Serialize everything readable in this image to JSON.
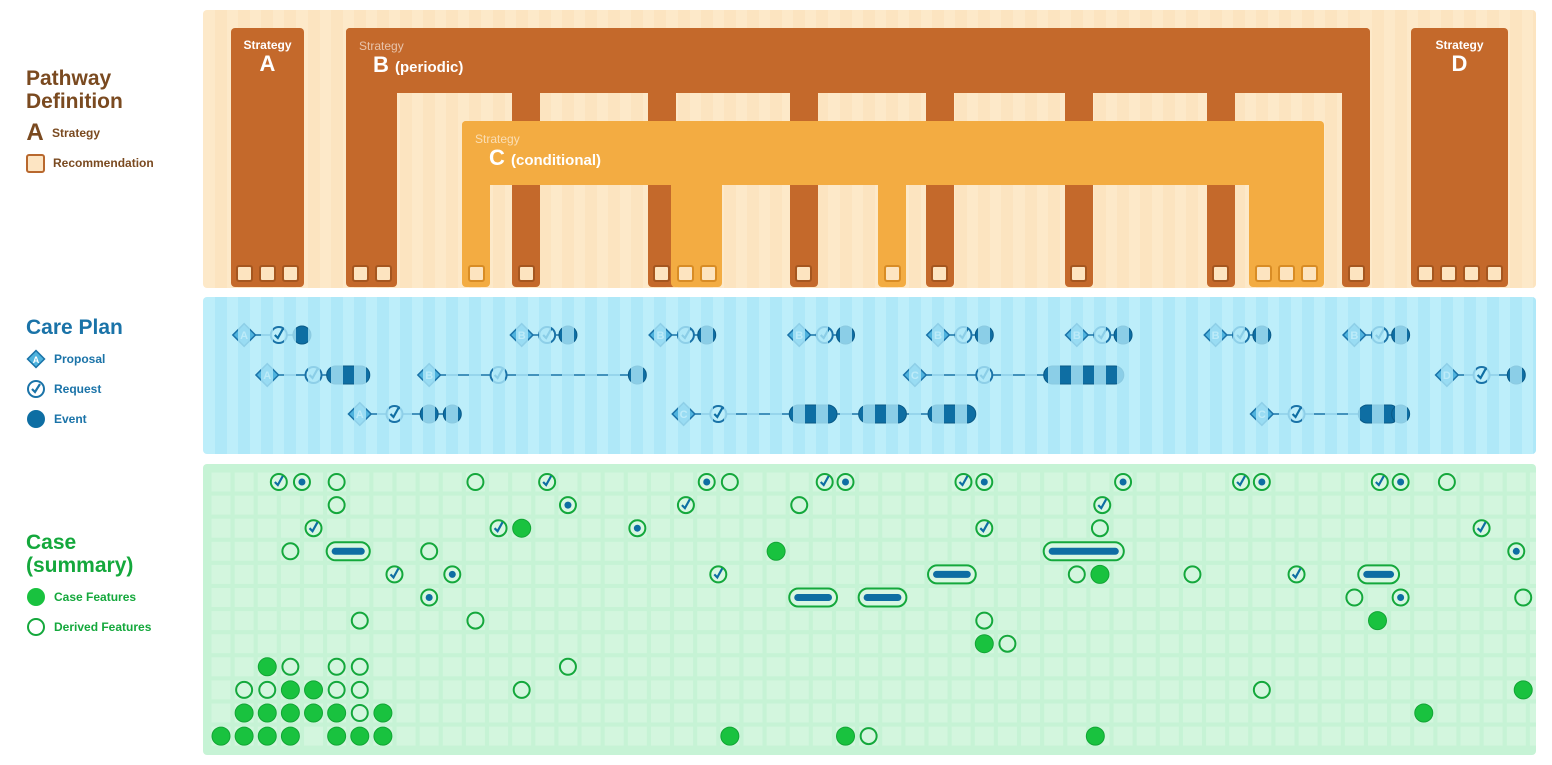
{
  "legends": {
    "pathway": {
      "title_line1": "Pathway",
      "title_line2": "Definition",
      "items": [
        {
          "symbol": "A",
          "label": "Strategy"
        },
        {
          "symbol": "recommendation-square",
          "label": "Recommendation"
        }
      ]
    },
    "careplan": {
      "title": "Care Plan",
      "items": [
        {
          "symbol": "A",
          "label": "Proposal"
        },
        {
          "symbol": "check-circle",
          "label": "Request"
        },
        {
          "symbol": "filled-circle",
          "label": "Event"
        }
      ]
    },
    "case": {
      "title_line1": "Case",
      "title_line2": "(summary)",
      "items": [
        {
          "symbol": "filled-circle",
          "label": "Case Features"
        },
        {
          "symbol": "hollow-circle",
          "label": "Derived Features"
        }
      ]
    }
  },
  "colors": {
    "pathway_text": "#7a4a20",
    "careplan_text": "#1a73a8",
    "case_text": "#14a83c",
    "strategy_dark": "#c4692b",
    "strategy_light": "#f3ac42",
    "event_blue": "#0e6ea3",
    "proposal_blue": "#4fb3de",
    "case_green": "#19c23f"
  },
  "pathway": {
    "strategies": [
      {
        "id": "A",
        "caption": "Strategy",
        "letter": "A",
        "suffix": "",
        "kind": "simple",
        "recommendations": 3
      },
      {
        "id": "B",
        "caption": "Strategy",
        "letter": "B",
        "suffix": "(periodic)",
        "kind": "periodic",
        "prong_recommendations": [
          2,
          1,
          1,
          1,
          1,
          1,
          1,
          1,
          1
        ]
      },
      {
        "id": "C",
        "caption": "Strategy",
        "letter": "C",
        "suffix": "(conditional)",
        "kind": "conditional",
        "prong_recommendations": [
          1,
          3,
          1,
          3
        ]
      },
      {
        "id": "D",
        "caption": "Strategy",
        "letter": "D",
        "suffix": "",
        "kind": "simple",
        "recommendations": 4
      }
    ]
  },
  "careplan": {
    "tracks": [
      {
        "strategy": "A",
        "lane": 0,
        "proposal": 1,
        "request": 2.5,
        "events": [
          {
            "t": 3.5
          }
        ]
      },
      {
        "strategy": "B",
        "lane": 0,
        "proposal": 13,
        "request": 14.1,
        "events": [
          {
            "t": 15
          }
        ]
      },
      {
        "strategy": "B",
        "lane": 0,
        "proposal": 19,
        "request": 20.1,
        "events": [
          {
            "t": 21
          }
        ]
      },
      {
        "strategy": "B",
        "lane": 0,
        "proposal": 25,
        "request": 26.1,
        "events": [
          {
            "t": 27
          }
        ]
      },
      {
        "strategy": "B",
        "lane": 0,
        "proposal": 31,
        "request": 32.1,
        "events": [
          {
            "t": 33
          }
        ]
      },
      {
        "strategy": "B",
        "lane": 0,
        "proposal": 37,
        "request": 38.1,
        "events": [
          {
            "t": 39
          }
        ]
      },
      {
        "strategy": "B",
        "lane": 0,
        "proposal": 43,
        "request": 44.1,
        "events": [
          {
            "t": 45
          }
        ]
      },
      {
        "strategy": "B",
        "lane": 0,
        "proposal": 49,
        "request": 50.1,
        "events": [
          {
            "t": 51
          }
        ]
      },
      {
        "strategy": "A",
        "lane": 1,
        "proposal": 2,
        "request": 4,
        "events": [
          {
            "t": 5,
            "t2": 6
          }
        ]
      },
      {
        "strategy": "B",
        "lane": 1,
        "proposal": 9,
        "request": 12,
        "events": [
          {
            "t": 18
          }
        ]
      },
      {
        "strategy": "C",
        "lane": 1,
        "proposal": 30,
        "request": 33,
        "events": [
          {
            "t": 36,
            "t2": 38.6
          }
        ]
      },
      {
        "strategy": "D",
        "lane": 1,
        "proposal": 53,
        "request": 54.5,
        "events": [
          {
            "t": 56
          }
        ]
      },
      {
        "strategy": "A",
        "lane": 2,
        "proposal": 6,
        "request": 7.5,
        "events": [
          {
            "t": 9
          },
          {
            "t": 10
          }
        ]
      },
      {
        "strategy": "C",
        "lane": 2,
        "proposal": 20,
        "request": 21.5,
        "events": [
          {
            "t": 25,
            "t2": 26.2
          },
          {
            "t": 28,
            "t2": 29.2
          },
          {
            "t": 31,
            "t2": 32.2
          }
        ]
      },
      {
        "strategy": "C",
        "lane": 2,
        "proposal": 45,
        "request": 46.5,
        "events": [
          {
            "t": 49.6,
            "t2": 50.5
          },
          {
            "t": 51
          }
        ]
      }
    ]
  },
  "case": {
    "rows": 12,
    "columns": 58,
    "items": [
      {
        "row": 0,
        "t": 2.5,
        "type": "request"
      },
      {
        "row": 0,
        "t": 3.5,
        "type": "event"
      },
      {
        "row": 0,
        "t": 5,
        "type": "derived"
      },
      {
        "row": 0,
        "t": 11,
        "type": "derived"
      },
      {
        "row": 0,
        "t": 14.1,
        "type": "request"
      },
      {
        "row": 0,
        "t": 21,
        "type": "event"
      },
      {
        "row": 0,
        "t": 22,
        "type": "derived"
      },
      {
        "row": 0,
        "t": 26.1,
        "type": "request"
      },
      {
        "row": 0,
        "t": 27,
        "type": "event"
      },
      {
        "row": 0,
        "t": 32.1,
        "type": "request"
      },
      {
        "row": 0,
        "t": 33,
        "type": "event"
      },
      {
        "row": 0,
        "t": 39,
        "type": "event"
      },
      {
        "row": 0,
        "t": 44.1,
        "type": "request"
      },
      {
        "row": 0,
        "t": 45,
        "type": "event"
      },
      {
        "row": 0,
        "t": 50.1,
        "type": "request"
      },
      {
        "row": 0,
        "t": 51,
        "type": "event"
      },
      {
        "row": 0,
        "t": 53,
        "type": "derived"
      },
      {
        "row": 1,
        "t": 5,
        "type": "derived"
      },
      {
        "row": 1,
        "t": 15,
        "type": "event"
      },
      {
        "row": 1,
        "t": 20.1,
        "type": "request"
      },
      {
        "row": 1,
        "t": 25,
        "type": "derived"
      },
      {
        "row": 1,
        "t": 38.1,
        "type": "request"
      },
      {
        "row": 2,
        "t": 4,
        "type": "request"
      },
      {
        "row": 2,
        "t": 12,
        "type": "request"
      },
      {
        "row": 2,
        "t": 13,
        "type": "case"
      },
      {
        "row": 2,
        "t": 18,
        "type": "event"
      },
      {
        "row": 2,
        "t": 33,
        "type": "request"
      },
      {
        "row": 2,
        "t": 38,
        "type": "derived"
      },
      {
        "row": 2,
        "t": 54.5,
        "type": "request"
      },
      {
        "row": 3,
        "t": 3,
        "type": "derived"
      },
      {
        "row": 3,
        "t": 5,
        "t2": 6,
        "type": "duration"
      },
      {
        "row": 3,
        "t": 9,
        "type": "derived"
      },
      {
        "row": 3,
        "t": 24,
        "type": "case"
      },
      {
        "row": 3,
        "t": 36,
        "t2": 38.6,
        "type": "duration"
      },
      {
        "row": 3,
        "t": 56,
        "type": "event"
      },
      {
        "row": 4,
        "t": 7.5,
        "type": "request"
      },
      {
        "row": 4,
        "t": 10,
        "type": "event"
      },
      {
        "row": 4,
        "t": 21.5,
        "type": "request"
      },
      {
        "row": 4,
        "t": 31,
        "t2": 32.2,
        "type": "duration"
      },
      {
        "row": 4,
        "t": 37,
        "type": "derived"
      },
      {
        "row": 4,
        "t": 38,
        "type": "case"
      },
      {
        "row": 4,
        "t": 42,
        "type": "derived"
      },
      {
        "row": 4,
        "t": 46.5,
        "type": "request"
      },
      {
        "row": 4,
        "t": 49.6,
        "t2": 50.5,
        "type": "duration"
      },
      {
        "row": 5,
        "t": 9,
        "type": "event"
      },
      {
        "row": 5,
        "t": 25,
        "t2": 26.2,
        "type": "duration"
      },
      {
        "row": 5,
        "t": 28,
        "t2": 29.2,
        "type": "duration"
      },
      {
        "row": 5,
        "t": 49,
        "type": "derived"
      },
      {
        "row": 5,
        "t": 51,
        "type": "event"
      },
      {
        "row": 5,
        "t": 56.3,
        "type": "derived"
      },
      {
        "row": 6,
        "t": 6,
        "type": "derived"
      },
      {
        "row": 6,
        "t": 11,
        "type": "derived"
      },
      {
        "row": 6,
        "t": 33,
        "type": "derived"
      },
      {
        "row": 6,
        "t": 50,
        "type": "case"
      },
      {
        "row": 7,
        "t": 33,
        "type": "case"
      },
      {
        "row": 7,
        "t": 34,
        "type": "derived"
      },
      {
        "row": 8,
        "t": 2,
        "type": "case"
      },
      {
        "row": 8,
        "t": 3,
        "type": "derived"
      },
      {
        "row": 8,
        "t": 5,
        "type": "derived"
      },
      {
        "row": 8,
        "t": 6,
        "type": "derived"
      },
      {
        "row": 8,
        "t": 15,
        "type": "derived"
      },
      {
        "row": 9,
        "t": 1,
        "type": "derived"
      },
      {
        "row": 9,
        "t": 2,
        "type": "derived"
      },
      {
        "row": 9,
        "t": 3,
        "type": "case"
      },
      {
        "row": 9,
        "t": 4,
        "type": "case"
      },
      {
        "row": 9,
        "t": 5,
        "type": "derived"
      },
      {
        "row": 9,
        "t": 6,
        "type": "derived"
      },
      {
        "row": 9,
        "t": 13,
        "type": "derived"
      },
      {
        "row": 9,
        "t": 45,
        "type": "derived"
      },
      {
        "row": 9,
        "t": 56.3,
        "type": "case"
      },
      {
        "row": 10,
        "t": 1,
        "type": "case"
      },
      {
        "row": 10,
        "t": 2,
        "type": "case"
      },
      {
        "row": 10,
        "t": 3,
        "type": "case"
      },
      {
        "row": 10,
        "t": 4,
        "type": "case"
      },
      {
        "row": 10,
        "t": 5,
        "type": "case"
      },
      {
        "row": 10,
        "t": 6,
        "type": "derived"
      },
      {
        "row": 10,
        "t": 7,
        "type": "case"
      },
      {
        "row": 10,
        "t": 52,
        "type": "case"
      },
      {
        "row": 11,
        "t": 0,
        "type": "case"
      },
      {
        "row": 11,
        "t": 1,
        "type": "case"
      },
      {
        "row": 11,
        "t": 2,
        "type": "case"
      },
      {
        "row": 11,
        "t": 3,
        "type": "case"
      },
      {
        "row": 11,
        "t": 5,
        "type": "case"
      },
      {
        "row": 11,
        "t": 6,
        "type": "case"
      },
      {
        "row": 11,
        "t": 7,
        "type": "case"
      },
      {
        "row": 11,
        "t": 22,
        "type": "case"
      },
      {
        "row": 11,
        "t": 27,
        "type": "case"
      },
      {
        "row": 11,
        "t": 28,
        "type": "derived"
      },
      {
        "row": 11,
        "t": 37.8,
        "type": "case"
      }
    ]
  }
}
